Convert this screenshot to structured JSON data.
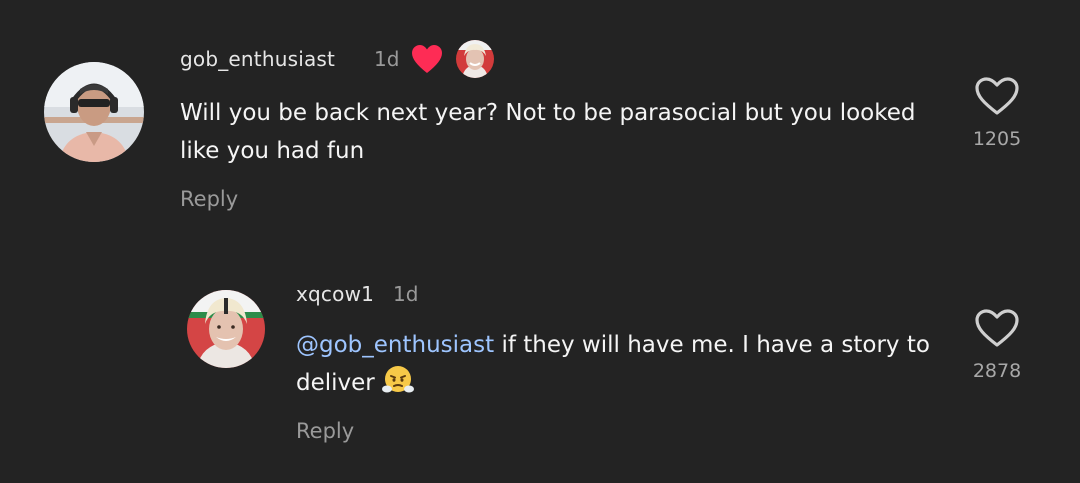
{
  "comments": [
    {
      "username": "gob_enthusiast",
      "time": "1d",
      "liked_by_creator": true,
      "text": "Will you be back next year? Not to be parasocial but you looked like you had fun",
      "reply_label": "Reply",
      "likes": "1205"
    },
    {
      "username": "xqcow1",
      "time": "1d",
      "mention": "@gob_enthusiast",
      "text": "if they will have me. I have a story to deliver",
      "emoji": "face-with-steam-from-nose",
      "reply_label": "Reply",
      "likes": "2878"
    }
  ],
  "colors": {
    "background": "#232323",
    "heart": "#fe2c55",
    "mention": "#9ec5ff",
    "secondary_text": "#9a9a9a"
  }
}
